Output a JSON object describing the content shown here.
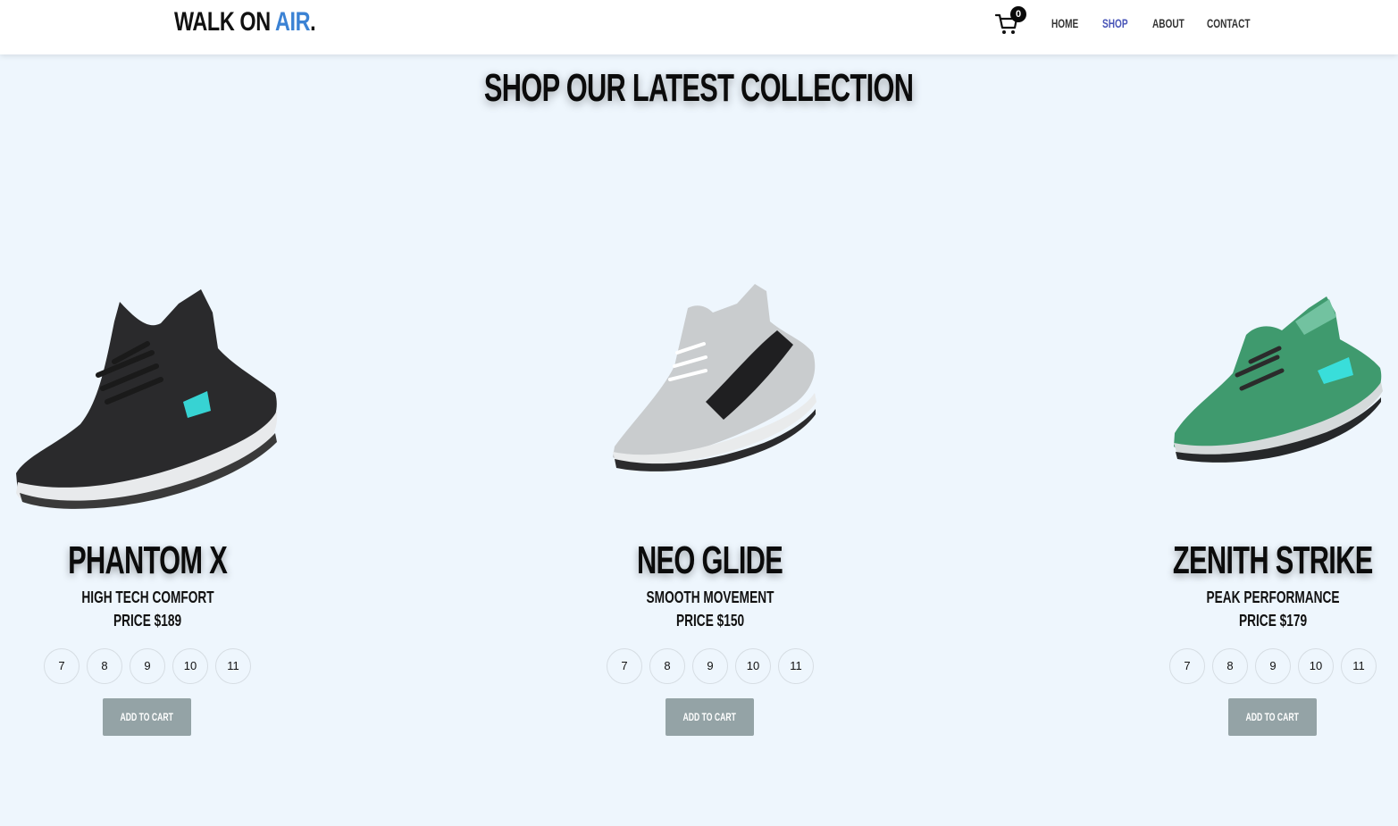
{
  "brand": {
    "main": "WALK ON ",
    "accent": "AIR",
    "dot": ".",
    "accent_color": "#3b82d4"
  },
  "cart": {
    "count": "0",
    "icon": "cart-icon"
  },
  "nav": {
    "items": [
      {
        "label": "HOME",
        "active": false
      },
      {
        "label": "SHOP",
        "active": true
      },
      {
        "label": "ABOUT",
        "active": false
      },
      {
        "label": "CONTACT",
        "active": false
      }
    ],
    "active_color": "#4a56b8"
  },
  "heading": "SHOP OUR LATEST COLLECTION",
  "products": [
    {
      "name": "PHANTOM X",
      "tagline": "HIGH TECH COMFORT",
      "price": "PRICE $189",
      "sizes": [
        "7",
        "8",
        "9",
        "10",
        "11"
      ],
      "button": "ADD TO CART",
      "colorway": "black knit with cyan light"
    },
    {
      "name": "NEO GLIDE",
      "tagline": "SMOOTH MOVEMENT",
      "price": "PRICE $150",
      "sizes": [
        "7",
        "8",
        "9",
        "10",
        "11"
      ],
      "button": "ADD TO CART",
      "colorway": "silver and black"
    },
    {
      "name": "ZENITH STRIKE",
      "tagline": "PEAK PERFORMANCE",
      "price": "PRICE $179",
      "sizes": [
        "7",
        "8",
        "9",
        "10",
        "11"
      ],
      "button": "ADD TO CART",
      "colorway": "green knit with cyan light"
    }
  ],
  "colors": {
    "background": "#eef6fd",
    "button": "#94a3a6"
  }
}
